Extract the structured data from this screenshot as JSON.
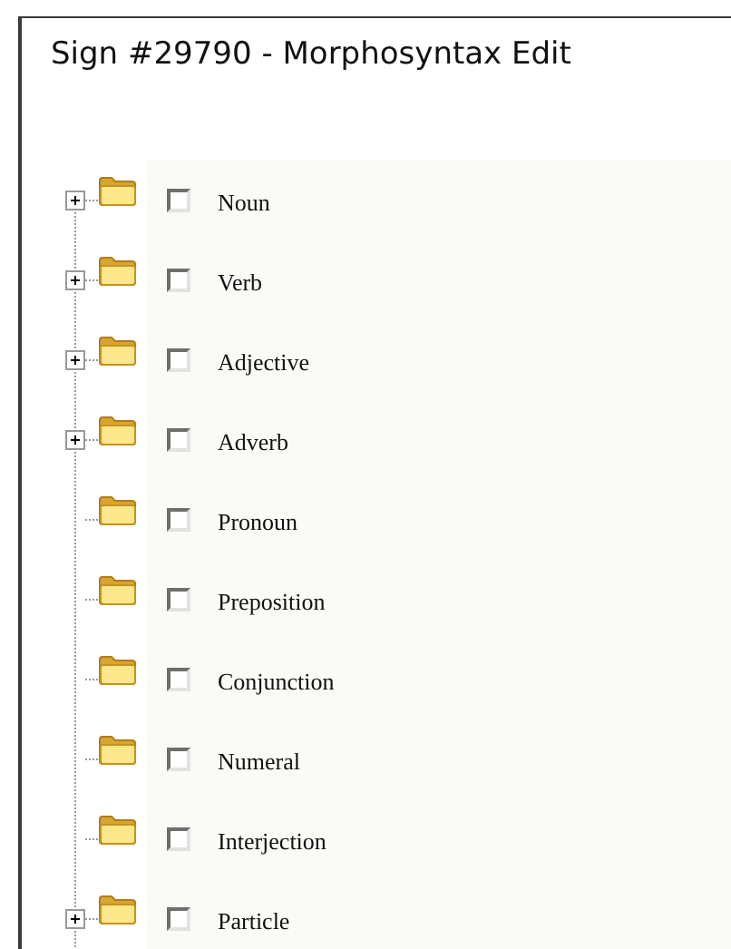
{
  "title": "Sign #29790 - Morphosyntax Edit",
  "tree": [
    {
      "label": "Noun",
      "has_children": true,
      "checked": false
    },
    {
      "label": "Verb",
      "has_children": true,
      "checked": false
    },
    {
      "label": "Adjective",
      "has_children": true,
      "checked": false
    },
    {
      "label": "Adverb",
      "has_children": true,
      "checked": false
    },
    {
      "label": "Pronoun",
      "has_children": false,
      "checked": false
    },
    {
      "label": "Preposition",
      "has_children": false,
      "checked": false
    },
    {
      "label": "Conjunction",
      "has_children": false,
      "checked": false
    },
    {
      "label": "Numeral",
      "has_children": false,
      "checked": false
    },
    {
      "label": "Interjection",
      "has_children": false,
      "checked": false
    },
    {
      "label": "Particle",
      "has_children": true,
      "checked": false
    }
  ]
}
